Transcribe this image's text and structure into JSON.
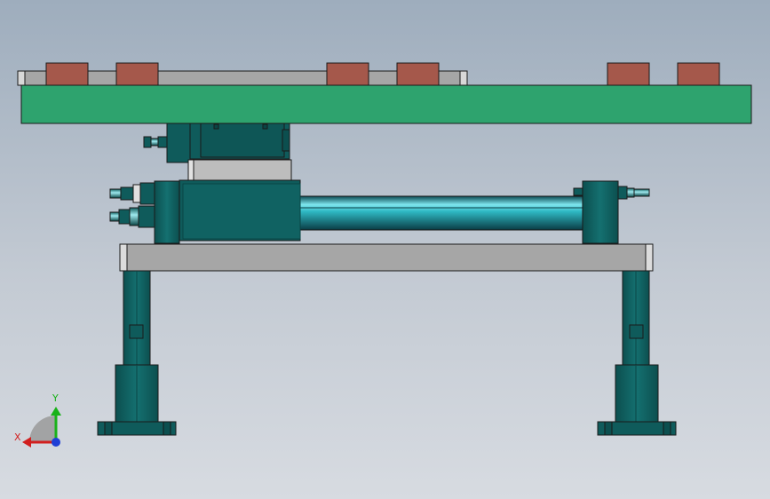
{
  "viewport": {
    "background_top": "#9eadbd",
    "background_bottom": "#d7dbe1"
  },
  "model": {
    "colors": {
      "plate_green": "#2ea36e",
      "block_red": "#a5584b",
      "rail_gray": "#a6a6a6",
      "teal": "#0f5b5b",
      "teal_dark": "#0a4545",
      "rod_cyan": "#2fb9c4",
      "outline": "#1a1a1a"
    }
  },
  "triad": {
    "x_label": "X",
    "y_label": "Y",
    "x_color": "#d11f1f",
    "y_color": "#19b219",
    "z_color": "#1f3fd6",
    "icon": "axis-triad-icon"
  }
}
